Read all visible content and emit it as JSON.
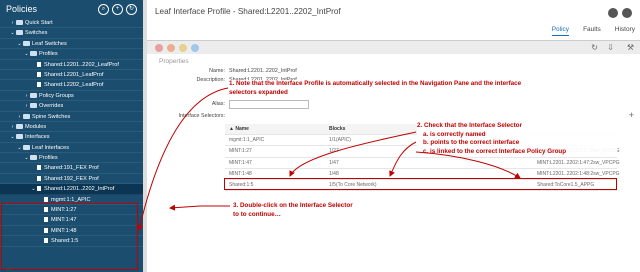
{
  "sidebar": {
    "title": "Policies",
    "items": [
      {
        "label": "Quick Start",
        "indent": 1,
        "kind": "quick",
        "arrow": "›"
      },
      {
        "label": "Switches",
        "indent": 1,
        "kind": "folder",
        "arrow": "⌄"
      },
      {
        "label": "Leaf Switches",
        "indent": 2,
        "kind": "folder",
        "arrow": "⌄"
      },
      {
        "label": "Profiles",
        "indent": 3,
        "kind": "folder",
        "arrow": "⌄"
      },
      {
        "label": "Shared:L2201..2202_LeafProf",
        "indent": 4,
        "kind": "doc",
        "arrow": ""
      },
      {
        "label": "Shared:L2201_LeafProf",
        "indent": 4,
        "kind": "doc",
        "arrow": ""
      },
      {
        "label": "Shared:L2202_LeafProf",
        "indent": 4,
        "kind": "doc",
        "arrow": ""
      },
      {
        "label": "Policy Groups",
        "indent": 3,
        "kind": "folder",
        "arrow": "›"
      },
      {
        "label": "Overrides",
        "indent": 3,
        "kind": "folder",
        "arrow": "›"
      },
      {
        "label": "Spine Switches",
        "indent": 2,
        "kind": "folder",
        "arrow": "›"
      },
      {
        "label": "Modules",
        "indent": 1,
        "kind": "folder",
        "arrow": "›"
      },
      {
        "label": "Interfaces",
        "indent": 1,
        "kind": "folder",
        "arrow": "⌄"
      },
      {
        "label": "Leaf Interfaces",
        "indent": 2,
        "kind": "folder",
        "arrow": "⌄"
      },
      {
        "label": "Profiles",
        "indent": 3,
        "kind": "folder",
        "arrow": "⌄"
      },
      {
        "label": "Shared:191_FEX Prof",
        "indent": 4,
        "kind": "doc",
        "arrow": ""
      },
      {
        "label": "Shared:192_FEX Prof",
        "indent": 4,
        "kind": "doc",
        "arrow": ""
      },
      {
        "label": "Shared:L2201..2202_IntProf",
        "indent": 4,
        "kind": "doc",
        "arrow": "⌄",
        "selected": true
      },
      {
        "label": "mgmt:1:1_APIC",
        "indent": 5,
        "kind": "doc",
        "arrow": ""
      },
      {
        "label": "MINT:1:27",
        "indent": 5,
        "kind": "doc",
        "arrow": ""
      },
      {
        "label": "MINT:1:47",
        "indent": 5,
        "kind": "doc",
        "arrow": ""
      },
      {
        "label": "MINT:1:48",
        "indent": 5,
        "kind": "doc",
        "arrow": ""
      },
      {
        "label": "Shared:1:5",
        "indent": 5,
        "kind": "doc",
        "arrow": ""
      }
    ]
  },
  "header": {
    "title": "Leaf Interface Profile - Shared:L2201..2202_IntProf",
    "tabs": [
      "Policy",
      "Faults",
      "History"
    ]
  },
  "properties": {
    "heading": "Properties",
    "name_label": "Name:",
    "name_value": "Shared:L2201..2202_IntProf",
    "desc_label": "Description:",
    "desc_value": "Shared:L2201_2202_IntProf",
    "alias_label": "Alias:",
    "selectors_label": "Interface Selectors:"
  },
  "table": {
    "headers": [
      "▲ Name",
      "Blocks",
      ""
    ],
    "rows": [
      [
        "mgmt:1:1_APIC",
        "1/1(APIC)",
        ""
      ],
      [
        "MINT:1:27",
        "1/27",
        "MINT:L2201..2202:1:27:2sw_VPCPG"
      ],
      [
        "MINT:1:47",
        "1/47",
        "MINT:L2201..2202:1:47:2sw_VPCPG"
      ],
      [
        "MINT:1:48",
        "1/48",
        "MINT:L2201..2202:1:48:2sw_VPCPG"
      ],
      [
        "Shared:1:5",
        "1/5(To Core Network)",
        "Shared:ToCore1.5_APPG"
      ]
    ]
  },
  "annotations": {
    "note1": "1.   Note that the Interface Profile is automatically selected in the Navigation Pane and the interface selectors expanded",
    "note2": [
      "2. Check that the Interface Selector",
      "a.    is correctly named",
      "b.    points to the correct interface",
      "c.    is linked to the correct Interface Policy Group"
    ],
    "note3": "3.   Double-click on the Interface Selector to to continue…"
  },
  "colors": {
    "nav_bg": "#1b4d6e",
    "annotation": "#c00000",
    "accent": "#1b6fb8"
  }
}
